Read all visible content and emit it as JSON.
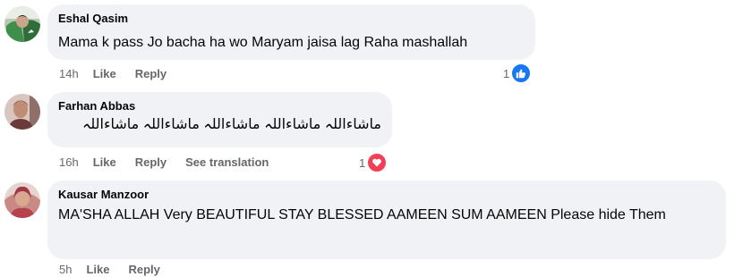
{
  "comments": [
    {
      "author": "Eshal Qasim",
      "text": "Mama k pass Jo bacha ha wo Maryam jaisa lag Raha mashallah",
      "time": "14h",
      "like_label": "Like",
      "reply_label": "Reply",
      "reaction_count": "1",
      "reaction_icon": "like-icon",
      "reaction_color": "#1877f2"
    },
    {
      "author": "Farhan Abbas",
      "text": "ماشاءاللہ ماشاءاللہ ماشاءاللہ ماشاءاللہ ماشاءاللہ",
      "time": "16h",
      "like_label": "Like",
      "reply_label": "Reply",
      "translation_label": "See translation",
      "reaction_count": "1",
      "reaction_icon": "love-icon",
      "reaction_color": "#f33e58"
    },
    {
      "author": "Kausar Manzoor",
      "text": "MA'SHA ALLAH Very BEAUTIFUL STAY BLESSED AAMEEN SUM AAMEEN Please hide Them",
      "time": "5h",
      "like_label": "Like",
      "reply_label": "Reply"
    }
  ],
  "colors": {
    "bubble_bg": "#f0f2f5",
    "text": "#050505",
    "secondary_text": "#65676b"
  }
}
